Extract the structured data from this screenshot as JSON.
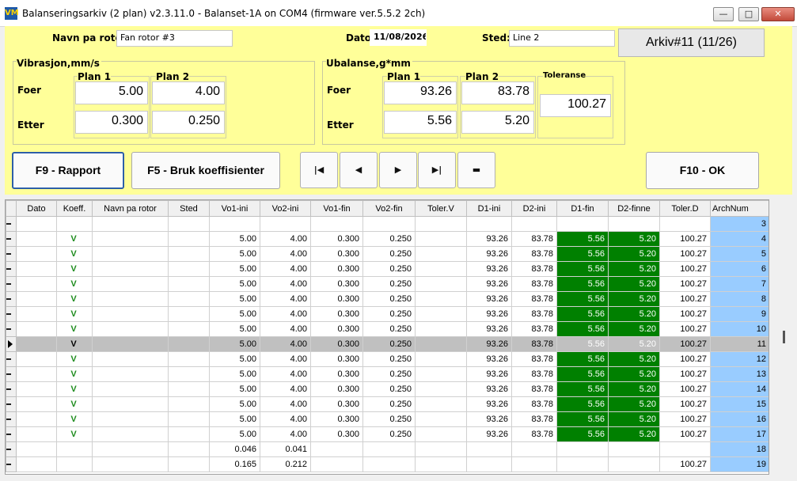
{
  "window": {
    "title": "Balanseringsarkiv (2 plan) v2.3.11.0 - Balanset-1A on COM4 (firmware ver.5.5.2 2ch)",
    "icon": "VM",
    "minimize": "—",
    "maximize": "□",
    "close": "✕"
  },
  "header": {
    "rotor_label": "Navn pa rotor",
    "rotor_value": "Fan rotor #3",
    "date_label": "Dato",
    "date_value": "11/08/2026",
    "place_label": "Sted:",
    "place_value": "Line 2",
    "archive_label": "Arkiv#11 (11/26)"
  },
  "vibration": {
    "title": "Vibrasjon,mm/s",
    "plan1": "Plan 1",
    "plan2": "Plan 2",
    "foer": "Foer",
    "etter": "Etter",
    "foer_p1": "5.00",
    "foer_p2": "4.00",
    "etter_p1": "0.300",
    "etter_p2": "0.250"
  },
  "unbalance": {
    "title": "Ubalanse,g*mm",
    "plan1": "Plan 1",
    "plan2": "Plan 2",
    "tolerance": "Toleranse",
    "foer": "Foer",
    "etter": "Etter",
    "foer_p1": "93.26",
    "foer_p2": "83.78",
    "etter_p1": "5.56",
    "etter_p2": "5.20",
    "tolerance_value": "100.27"
  },
  "buttons": {
    "report": "F9 - Rapport",
    "coefficients": "F5 - Bruk koeffisienter",
    "first": "|◀",
    "prev": "◀",
    "next": "▶",
    "last": "▶|",
    "delete": "▬",
    "ok": "F10 - OK"
  },
  "grid": {
    "columns": [
      "Dato",
      "Koeff.",
      "Navn pa rotor",
      "Sted",
      "Vo1-ini",
      "Vo2-ini",
      "Vo1-fin",
      "Vo2-fin",
      "Toler.V",
      "D1-ini",
      "D2-ini",
      "D1-fin",
      "D2-finne",
      "Toler.D",
      "ArchNum"
    ],
    "rows": [
      {
        "dato": "",
        "koeff": "",
        "navn": "",
        "sted": "",
        "vo1i": "",
        "vo2i": "",
        "vo1f": "",
        "vo2f": "",
        "tolv": "",
        "d1i": "",
        "d2i": "",
        "d1f": "",
        "d2f": "",
        "told": "",
        "arch": "3"
      },
      {
        "dato": "",
        "koeff": "V",
        "navn": "",
        "sted": "",
        "vo1i": "5.00",
        "vo2i": "4.00",
        "vo1f": "0.300",
        "vo2f": "0.250",
        "tolv": "",
        "d1i": "93.26",
        "d2i": "83.78",
        "d1f": "5.56",
        "d2f": "5.20",
        "told": "100.27",
        "arch": "4"
      },
      {
        "dato": "",
        "koeff": "V",
        "navn": "",
        "sted": "",
        "vo1i": "5.00",
        "vo2i": "4.00",
        "vo1f": "0.300",
        "vo2f": "0.250",
        "tolv": "",
        "d1i": "93.26",
        "d2i": "83.78",
        "d1f": "5.56",
        "d2f": "5.20",
        "told": "100.27",
        "arch": "5"
      },
      {
        "dato": "",
        "koeff": "V",
        "navn": "",
        "sted": "",
        "vo1i": "5.00",
        "vo2i": "4.00",
        "vo1f": "0.300",
        "vo2f": "0.250",
        "tolv": "",
        "d1i": "93.26",
        "d2i": "83.78",
        "d1f": "5.56",
        "d2f": "5.20",
        "told": "100.27",
        "arch": "6"
      },
      {
        "dato": "",
        "koeff": "V",
        "navn": "",
        "sted": "",
        "vo1i": "5.00",
        "vo2i": "4.00",
        "vo1f": "0.300",
        "vo2f": "0.250",
        "tolv": "",
        "d1i": "93.26",
        "d2i": "83.78",
        "d1f": "5.56",
        "d2f": "5.20",
        "told": "100.27",
        "arch": "7"
      },
      {
        "dato": "",
        "koeff": "V",
        "navn": "",
        "sted": "",
        "vo1i": "5.00",
        "vo2i": "4.00",
        "vo1f": "0.300",
        "vo2f": "0.250",
        "tolv": "",
        "d1i": "93.26",
        "d2i": "83.78",
        "d1f": "5.56",
        "d2f": "5.20",
        "told": "100.27",
        "arch": "8"
      },
      {
        "dato": "",
        "koeff": "V",
        "navn": "",
        "sted": "",
        "vo1i": "5.00",
        "vo2i": "4.00",
        "vo1f": "0.300",
        "vo2f": "0.250",
        "tolv": "",
        "d1i": "93.26",
        "d2i": "83.78",
        "d1f": "5.56",
        "d2f": "5.20",
        "told": "100.27",
        "arch": "9"
      },
      {
        "dato": "",
        "koeff": "V",
        "navn": "",
        "sted": "",
        "vo1i": "5.00",
        "vo2i": "4.00",
        "vo1f": "0.300",
        "vo2f": "0.250",
        "tolv": "",
        "d1i": "93.26",
        "d2i": "83.78",
        "d1f": "5.56",
        "d2f": "5.20",
        "told": "100.27",
        "arch": "10"
      },
      {
        "dato": "",
        "koeff": "V",
        "navn": "",
        "sted": "",
        "vo1i": "5.00",
        "vo2i": "4.00",
        "vo1f": "0.300",
        "vo2f": "0.250",
        "tolv": "",
        "d1i": "93.26",
        "d2i": "83.78",
        "d1f": "5.56",
        "d2f": "5.20",
        "told": "100.27",
        "arch": "11",
        "selected": true
      },
      {
        "dato": "",
        "koeff": "V",
        "navn": "",
        "sted": "",
        "vo1i": "5.00",
        "vo2i": "4.00",
        "vo1f": "0.300",
        "vo2f": "0.250",
        "tolv": "",
        "d1i": "93.26",
        "d2i": "83.78",
        "d1f": "5.56",
        "d2f": "5.20",
        "told": "100.27",
        "arch": "12"
      },
      {
        "dato": "",
        "koeff": "V",
        "navn": "",
        "sted": "",
        "vo1i": "5.00",
        "vo2i": "4.00",
        "vo1f": "0.300",
        "vo2f": "0.250",
        "tolv": "",
        "d1i": "93.26",
        "d2i": "83.78",
        "d1f": "5.56",
        "d2f": "5.20",
        "told": "100.27",
        "arch": "13"
      },
      {
        "dato": "",
        "koeff": "V",
        "navn": "",
        "sted": "",
        "vo1i": "5.00",
        "vo2i": "4.00",
        "vo1f": "0.300",
        "vo2f": "0.250",
        "tolv": "",
        "d1i": "93.26",
        "d2i": "83.78",
        "d1f": "5.56",
        "d2f": "5.20",
        "told": "100.27",
        "arch": "14"
      },
      {
        "dato": "",
        "koeff": "V",
        "navn": "",
        "sted": "",
        "vo1i": "5.00",
        "vo2i": "4.00",
        "vo1f": "0.300",
        "vo2f": "0.250",
        "tolv": "",
        "d1i": "93.26",
        "d2i": "83.78",
        "d1f": "5.56",
        "d2f": "5.20",
        "told": "100.27",
        "arch": "15"
      },
      {
        "dato": "",
        "koeff": "V",
        "navn": "",
        "sted": "",
        "vo1i": "5.00",
        "vo2i": "4.00",
        "vo1f": "0.300",
        "vo2f": "0.250",
        "tolv": "",
        "d1i": "93.26",
        "d2i": "83.78",
        "d1f": "5.56",
        "d2f": "5.20",
        "told": "100.27",
        "arch": "16"
      },
      {
        "dato": "",
        "koeff": "V",
        "navn": "",
        "sted": "",
        "vo1i": "5.00",
        "vo2i": "4.00",
        "vo1f": "0.300",
        "vo2f": "0.250",
        "tolv": "",
        "d1i": "93.26",
        "d2i": "83.78",
        "d1f": "5.56",
        "d2f": "5.20",
        "told": "100.27",
        "arch": "17"
      },
      {
        "dato": "",
        "koeff": "",
        "navn": "",
        "sted": "",
        "vo1i": "0.046",
        "vo2i": "0.041",
        "vo1f": "",
        "vo2f": "",
        "tolv": "",
        "d1i": "",
        "d2i": "",
        "d1f": "",
        "d2f": "",
        "told": "",
        "arch": "18"
      },
      {
        "dato": "",
        "koeff": "",
        "navn": "",
        "sted": "",
        "vo1i": "0.165",
        "vo2i": "0.212",
        "vo1f": "",
        "vo2f": "",
        "tolv": "",
        "d1i": "",
        "d2i": "",
        "d1f": "",
        "d2f": "",
        "told": "100.27",
        "arch": "19"
      }
    ]
  },
  "colors": {
    "panel_bg": "#ffff99",
    "fin_cell_bg": "#008000",
    "archnum_bg": "#99ccff",
    "selected_row_bg": "#c0c0c0",
    "koeff_check": "#1e8c1e"
  }
}
